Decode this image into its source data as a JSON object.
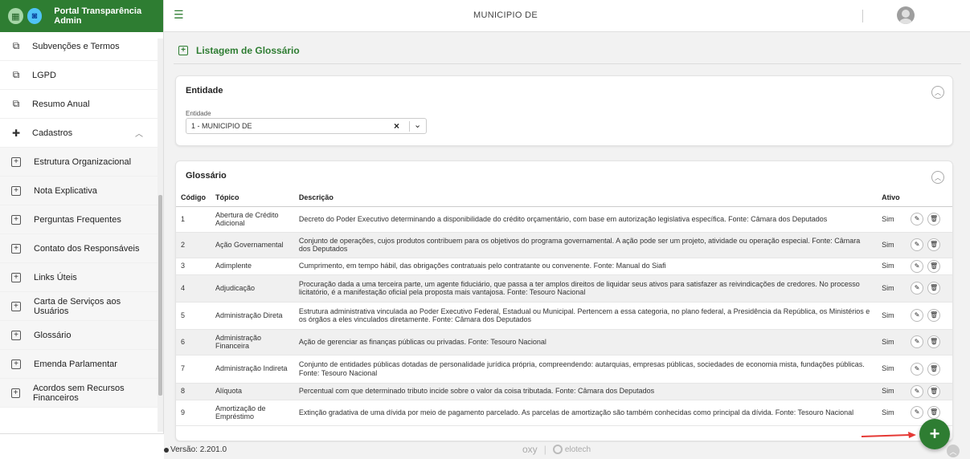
{
  "brand": {
    "title": "Portal Transparência Admin"
  },
  "menu": [
    {
      "label": "Subvenções e Termos",
      "icon": "documents-icon",
      "type": "main"
    },
    {
      "label": "LGPD",
      "icon": "documents-icon",
      "type": "main"
    },
    {
      "label": "Resumo Anual",
      "icon": "documents-icon",
      "type": "main"
    },
    {
      "label": "Cadastros",
      "icon": "plus-icon",
      "type": "group"
    },
    {
      "label": "Estrutura Organizacional",
      "icon": "plus-square-icon",
      "type": "sub"
    },
    {
      "label": "Nota Explicativa",
      "icon": "plus-square-icon",
      "type": "sub"
    },
    {
      "label": "Perguntas Frequentes",
      "icon": "plus-square-icon",
      "type": "sub"
    },
    {
      "label": "Contato dos Responsáveis",
      "icon": "plus-square-icon",
      "type": "sub"
    },
    {
      "label": "Links Úteis",
      "icon": "plus-square-icon",
      "type": "sub"
    },
    {
      "label": "Carta de Serviços aos Usuários",
      "icon": "plus-square-icon",
      "type": "sub"
    },
    {
      "label": "Glossário",
      "icon": "plus-square-icon",
      "type": "sub"
    },
    {
      "label": "Emenda Parlamentar",
      "icon": "plus-square-icon",
      "type": "sub"
    },
    {
      "label": "Acordos sem Recursos Financeiros",
      "icon": "plus-square-icon",
      "type": "sub"
    }
  ],
  "header": {
    "municipio": "MUNICIPIO DE"
  },
  "page": {
    "title": "Listagem de Glossário"
  },
  "entidade": {
    "card_title": "Entidade",
    "field_label": "Entidade",
    "selected_value": "1 - MUNICIPIO DE"
  },
  "glossario": {
    "card_title": "Glossário",
    "columns": {
      "codigo": "Código",
      "topico": "Tópico",
      "descricao": "Descrição",
      "ativo": "Ativo"
    },
    "rows": [
      {
        "codigo": "1",
        "topico": "Abertura de Crédito Adicional",
        "descricao": "Decreto do Poder Executivo determinando a disponibilidade do crédito orçamentário, com base em autorização legislativa específica. Fonte: Câmara dos Deputados",
        "ativo": "Sim"
      },
      {
        "codigo": "2",
        "topico": "Ação Governamental",
        "descricao": "Conjunto de operações, cujos produtos contribuem para os objetivos do programa governamental. A ação pode ser um projeto, atividade ou operação especial. Fonte: Câmara dos Deputados",
        "ativo": "Sim"
      },
      {
        "codigo": "3",
        "topico": "Adimplente",
        "descricao": "Cumprimento, em tempo hábil, das obrigações contratuais pelo contratante ou convenente. Fonte: Manual do Siafi",
        "ativo": "Sim"
      },
      {
        "codigo": "4",
        "topico": "Adjudicação",
        "descricao": "Procuração dada a uma terceira parte, um agente fiduciário, que passa a ter amplos direitos de liquidar seus ativos para satisfazer as reivindicações de credores. No processo licitatório, é a manifestação oficial pela proposta mais vantajosa. Fonte: Tesouro Nacional",
        "ativo": "Sim"
      },
      {
        "codigo": "5",
        "topico": "Administração Direta",
        "descricao": "Estrutura administrativa vinculada ao Poder Executivo Federal, Estadual ou Municipal. Pertencem a essa categoria, no plano federal, a Presidência da República, os Ministérios e os órgãos a eles vinculados diretamente. Fonte: Câmara dos Deputados",
        "ativo": "Sim"
      },
      {
        "codigo": "6",
        "topico": "Administração Financeira",
        "descricao": "Ação de gerenciar as finanças públicas ou privadas. Fonte: Tesouro Nacional",
        "ativo": "Sim"
      },
      {
        "codigo": "7",
        "topico": "Administração Indireta",
        "descricao": "Conjunto de entidades públicas dotadas de personalidade jurídica própria, compreendendo: autarquias, empresas públicas, sociedades de economia mista, fundações públicas. Fonte: Tesouro Nacional",
        "ativo": "Sim"
      },
      {
        "codigo": "8",
        "topico": "Alíquota",
        "descricao": "Percentual com que determinado tributo incide sobre o valor da coisa tributada. Fonte: Câmara dos Deputados",
        "ativo": "Sim"
      },
      {
        "codigo": "9",
        "topico": "Amortização de Empréstimo",
        "descricao": "Extinção gradativa de uma dívida por meio de pagamento parcelado. As parcelas de amortização são também conhecidas como principal da dívida. Fonte: Tesouro Nacional",
        "ativo": "Sim"
      }
    ]
  },
  "footer": {
    "version": "Versão: 2.201.0",
    "brand1": "oxy",
    "brand2": "elotech"
  },
  "colors": {
    "primary": "#2e7d32",
    "alt_row": "#f0f0f0",
    "arrow": "#e53935"
  }
}
